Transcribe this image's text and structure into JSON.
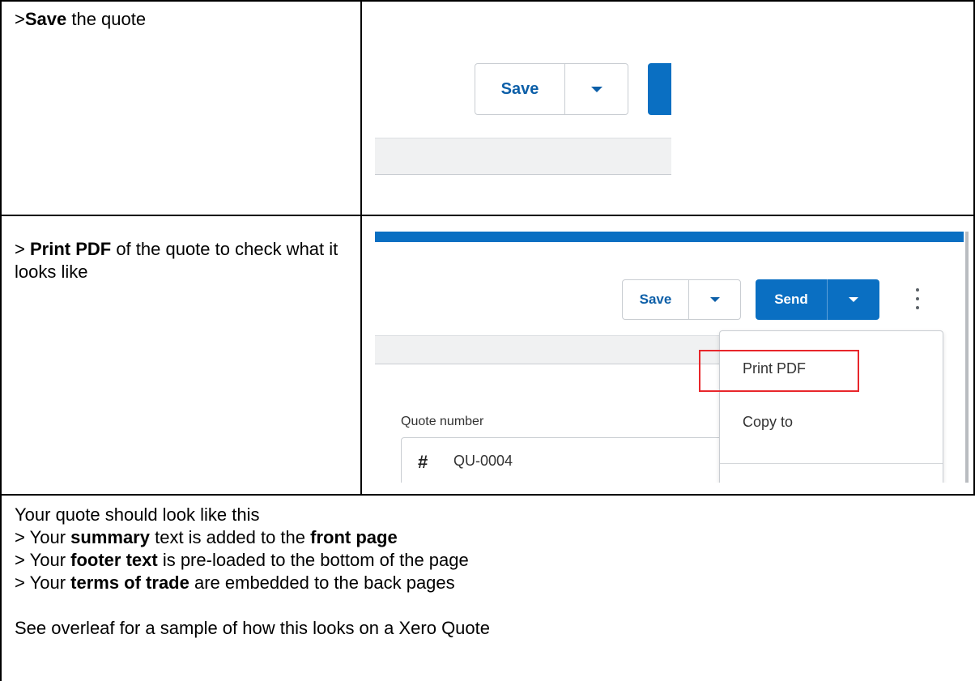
{
  "row1": {
    "prefix": ">",
    "bold": "Save",
    "suffix": " the quote"
  },
  "row2": {
    "prefix": "> ",
    "bold": "Print PDF",
    "suffix": " of the quote to check what it looks like"
  },
  "screenshot1": {
    "save_label": "Save"
  },
  "screenshot2": {
    "save_label": "Save",
    "send_label": "Send",
    "menu_items": [
      "Print PDF",
      "Copy to"
    ],
    "quote_number_label": "Quote number",
    "quote_number_symbol": "#",
    "quote_number_value": "QU-0004"
  },
  "bottom": {
    "intro": "Your quote should look like this",
    "bullet1": {
      "a": "> Your ",
      "b1": "summary",
      "c": " text is added to the ",
      "b2": "front page"
    },
    "bullet2": {
      "a": "> Your ",
      "b1": "footer text",
      "c": " is pre-loaded to the bottom of the page"
    },
    "bullet3": {
      "a": "> Your ",
      "b1": "terms of trade",
      "c": " are embedded to the back pages"
    },
    "overleaf": "See overleaf for a sample of how this looks on a Xero Quote"
  },
  "colors": {
    "xero_blue": "#0a6fc2",
    "link_blue": "#0c5fa8",
    "highlight_red": "#e8262b"
  }
}
